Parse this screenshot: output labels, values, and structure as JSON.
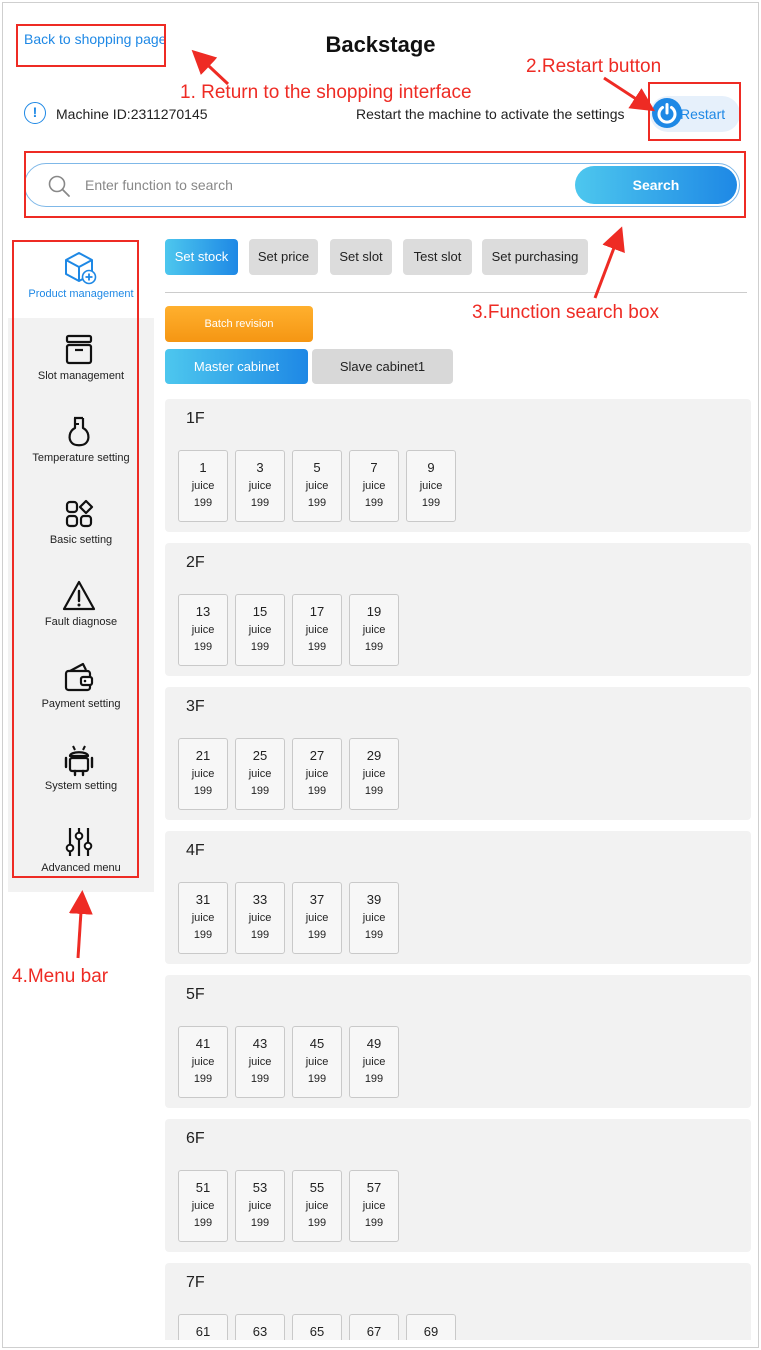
{
  "header": {
    "back_link": "Back to shopping page",
    "title": "Backstage",
    "machine_id": "Machine ID:2311270145",
    "restart_hint": "Restart the machine to activate the settings",
    "restart_label": "Restart"
  },
  "search": {
    "placeholder": "Enter function to search",
    "value": "",
    "button_label": "Search"
  },
  "annotations": {
    "return_note": "1. Return to the shopping interface",
    "restart_note": "2.Restart button",
    "search_note": "3.Function search box",
    "menu_note": "4.Menu bar",
    "accent_color": "#ee2b24"
  },
  "sidebar": {
    "items": [
      {
        "label": "Product management",
        "icon": "cube-plus-icon",
        "active": true
      },
      {
        "label": "Slot management",
        "icon": "drawer-icon",
        "active": false
      },
      {
        "label": "Temperature setting",
        "icon": "flask-icon",
        "active": false
      },
      {
        "label": "Basic setting",
        "icon": "apps-icon",
        "active": false
      },
      {
        "label": "Fault diagnose",
        "icon": "warning-icon",
        "active": false
      },
      {
        "label": "Payment setting",
        "icon": "wallet-icon",
        "active": false
      },
      {
        "label": "System setting",
        "icon": "android-icon",
        "active": false
      },
      {
        "label": "Advanced menu",
        "icon": "sliders-icon",
        "active": false
      }
    ]
  },
  "tabs": [
    {
      "label": "Set stock",
      "active": true
    },
    {
      "label": "Set price",
      "active": false
    },
    {
      "label": "Set slot",
      "active": false
    },
    {
      "label": "Test slot",
      "active": false
    },
    {
      "label": "Set purchasing",
      "active": false
    }
  ],
  "batch_label": "Batch revision",
  "cabinets": [
    {
      "label": "Master cabinet",
      "active": true
    },
    {
      "label": "Slave cabinet1",
      "active": false
    }
  ],
  "floors": [
    {
      "title": "1F",
      "slots": [
        {
          "no": "1",
          "name": "juice",
          "stock": "199"
        },
        {
          "no": "3",
          "name": "juice",
          "stock": "199"
        },
        {
          "no": "5",
          "name": "juice",
          "stock": "199"
        },
        {
          "no": "7",
          "name": "juice",
          "stock": "199"
        },
        {
          "no": "9",
          "name": "juice",
          "stock": "199"
        }
      ]
    },
    {
      "title": "2F",
      "slots": [
        {
          "no": "13",
          "name": "juice",
          "stock": "199"
        },
        {
          "no": "15",
          "name": "juice",
          "stock": "199"
        },
        {
          "no": "17",
          "name": "juice",
          "stock": "199"
        },
        {
          "no": "19",
          "name": "juice",
          "stock": "199"
        }
      ]
    },
    {
      "title": "3F",
      "slots": [
        {
          "no": "21",
          "name": "juice",
          "stock": "199"
        },
        {
          "no": "25",
          "name": "juice",
          "stock": "199"
        },
        {
          "no": "27",
          "name": "juice",
          "stock": "199"
        },
        {
          "no": "29",
          "name": "juice",
          "stock": "199"
        }
      ]
    },
    {
      "title": "4F",
      "slots": [
        {
          "no": "31",
          "name": "juice",
          "stock": "199"
        },
        {
          "no": "33",
          "name": "juice",
          "stock": "199"
        },
        {
          "no": "37",
          "name": "juice",
          "stock": "199"
        },
        {
          "no": "39",
          "name": "juice",
          "stock": "199"
        }
      ]
    },
    {
      "title": "5F",
      "slots": [
        {
          "no": "41",
          "name": "juice",
          "stock": "199"
        },
        {
          "no": "43",
          "name": "juice",
          "stock": "199"
        },
        {
          "no": "45",
          "name": "juice",
          "stock": "199"
        },
        {
          "no": "49",
          "name": "juice",
          "stock": "199"
        }
      ]
    },
    {
      "title": "6F",
      "slots": [
        {
          "no": "51",
          "name": "juice",
          "stock": "199"
        },
        {
          "no": "53",
          "name": "juice",
          "stock": "199"
        },
        {
          "no": "55",
          "name": "juice",
          "stock": "199"
        },
        {
          "no": "57",
          "name": "juice",
          "stock": "199"
        }
      ]
    },
    {
      "title": "7F",
      "slots": [
        {
          "no": "61",
          "name": "",
          "stock": ""
        },
        {
          "no": "63",
          "name": "",
          "stock": ""
        },
        {
          "no": "65",
          "name": "",
          "stock": ""
        },
        {
          "no": "67",
          "name": "",
          "stock": ""
        },
        {
          "no": "69",
          "name": "",
          "stock": ""
        }
      ]
    }
  ]
}
